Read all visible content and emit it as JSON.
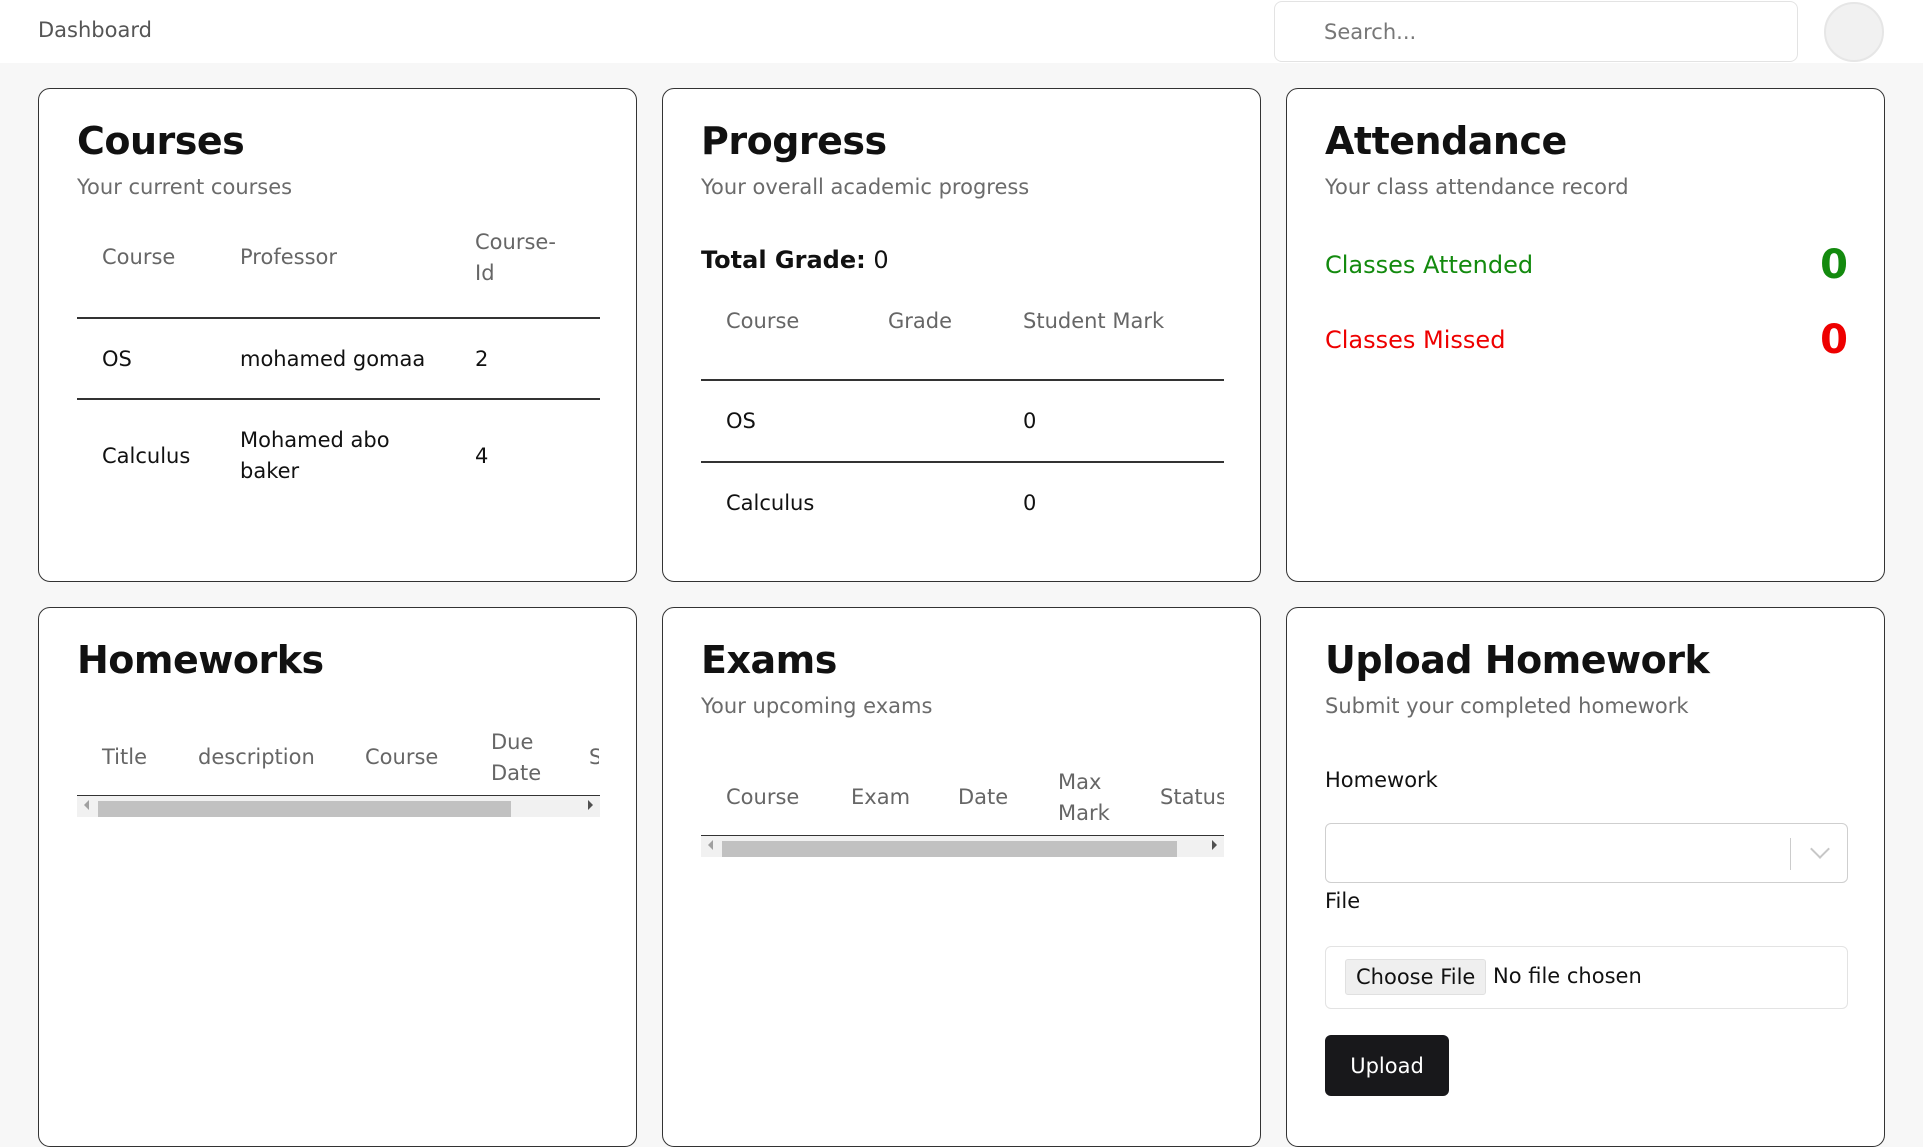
{
  "header": {
    "breadcrumb": "Dashboard",
    "search_placeholder": "Search..."
  },
  "courses": {
    "title": "Courses",
    "subtitle": "Your current courses",
    "columns": [
      "Course",
      "Professor",
      "Course-\nId"
    ],
    "rows": [
      {
        "course": "OS",
        "professor": "mohamed gomaa",
        "course_id": "2"
      },
      {
        "course": "Calculus",
        "professor": "Mohamed abo\nbaker",
        "course_id": "4"
      }
    ]
  },
  "progress": {
    "title": "Progress",
    "subtitle": "Your overall academic progress",
    "total_grade_label": "Total Grade:",
    "total_grade_value": "0",
    "columns": [
      "Course",
      "Grade",
      "Student Mark"
    ],
    "rows": [
      {
        "course": "OS",
        "grade": "",
        "mark": "0"
      },
      {
        "course": "Calculus",
        "grade": "",
        "mark": "0"
      }
    ]
  },
  "attendance": {
    "title": "Attendance",
    "subtitle": "Your class attendance record",
    "attended_label": "Classes Attended",
    "attended_value": "0",
    "missed_label": "Classes Missed",
    "missed_value": "0",
    "attended_color": "#138a0e",
    "missed_color": "#ee0000"
  },
  "homeworks": {
    "title": "Homeworks",
    "columns": [
      "Title",
      "description",
      "Course",
      "Due\nDate",
      "S"
    ]
  },
  "exams": {
    "title": "Exams",
    "subtitle": "Your upcoming exams",
    "columns": [
      "Course",
      "Exam",
      "Date",
      "Max\nMark",
      "Status"
    ]
  },
  "upload": {
    "title": "Upload Homework",
    "subtitle": "Submit your completed homework",
    "homework_label": "Homework",
    "file_label": "File",
    "choose_file_label": "Choose File",
    "no_file_text": "No file chosen",
    "upload_button": "Upload"
  }
}
